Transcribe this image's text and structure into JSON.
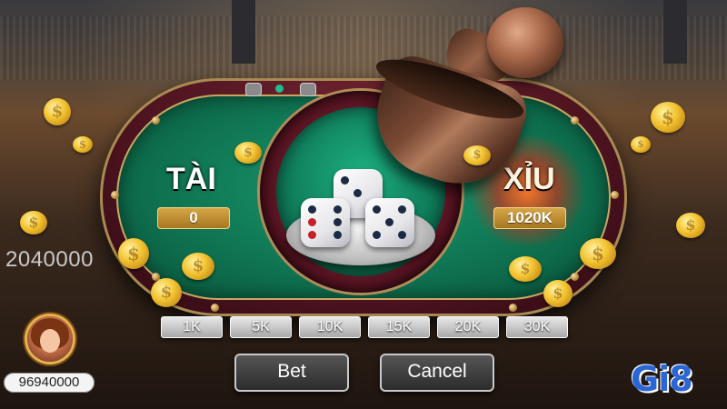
{
  "game": {
    "left_side": {
      "title": "TÀI",
      "amount": "0"
    },
    "right_side": {
      "title": "XỈU",
      "amount": "1020K"
    },
    "dice": [
      3,
      6,
      5
    ]
  },
  "player": {
    "table_balance": "2040000",
    "wallet_balance": "96940000"
  },
  "chips": [
    "1K",
    "5K",
    "10K",
    "15K",
    "20K",
    "30K"
  ],
  "actions": {
    "bet_label": "Bet",
    "cancel_label": "Cancel"
  },
  "brand": {
    "logo_text": "Gi8"
  },
  "colors": {
    "table_felt": "#0f7452",
    "rail": "#4e1420",
    "gold": "#d7a84a",
    "logo": "#2a66d6"
  }
}
